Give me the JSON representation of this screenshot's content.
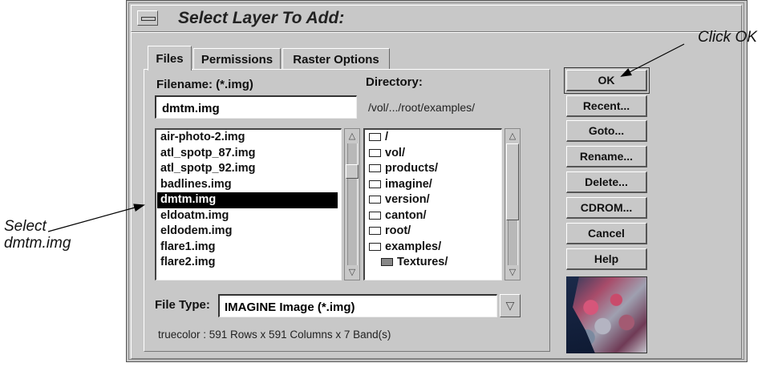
{
  "dialog": {
    "title": "Select Layer To Add:",
    "tabs": [
      {
        "label": "Files",
        "active": true
      },
      {
        "label": "Permissions",
        "active": false
      },
      {
        "label": "Raster Options",
        "active": false
      }
    ],
    "filename_label": "Filename: (*.img)",
    "filename_value": "dmtm.img",
    "directory_label": "Directory:",
    "directory_path": "/vol/.../root/examples/",
    "files": [
      {
        "name": "air-photo-2.img",
        "selected": false
      },
      {
        "name": "atl_spotp_87.img",
        "selected": false
      },
      {
        "name": "atl_spotp_92.img",
        "selected": false
      },
      {
        "name": "badlines.img",
        "selected": false
      },
      {
        "name": "dmtm.img",
        "selected": true
      },
      {
        "name": "eldoatm.img",
        "selected": false
      },
      {
        "name": "eldodem.img",
        "selected": false
      },
      {
        "name": "flare1.img",
        "selected": false
      },
      {
        "name": "flare2.img",
        "selected": false
      }
    ],
    "directories": [
      {
        "name": "/",
        "icon": "open-folder-icon"
      },
      {
        "name": "vol/",
        "icon": "open-folder-icon"
      },
      {
        "name": "products/",
        "icon": "open-folder-icon"
      },
      {
        "name": "imagine/",
        "icon": "open-folder-icon"
      },
      {
        "name": "version/",
        "icon": "open-folder-icon"
      },
      {
        "name": "canton/",
        "icon": "open-folder-icon"
      },
      {
        "name": "root/",
        "icon": "open-folder-icon"
      },
      {
        "name": "examples/",
        "icon": "open-folder-icon"
      },
      {
        "name": "Textures/",
        "icon": "closed-folder-icon"
      }
    ],
    "file_type_label": "File Type:",
    "file_type_value": "IMAGINE Image (*.img)",
    "status": "truecolor : 591 Rows x 591 Columns x 7 Band(s)",
    "buttons": {
      "ok": "OK",
      "recent": "Recent...",
      "goto": "Goto...",
      "rename": "Rename...",
      "delete": "Delete...",
      "cdrom": "CDROM...",
      "cancel": "Cancel",
      "help": "Help"
    }
  },
  "annotations": {
    "click_ok": "Click OK",
    "select_line1": "Select",
    "select_line2": "dmtm.img"
  }
}
